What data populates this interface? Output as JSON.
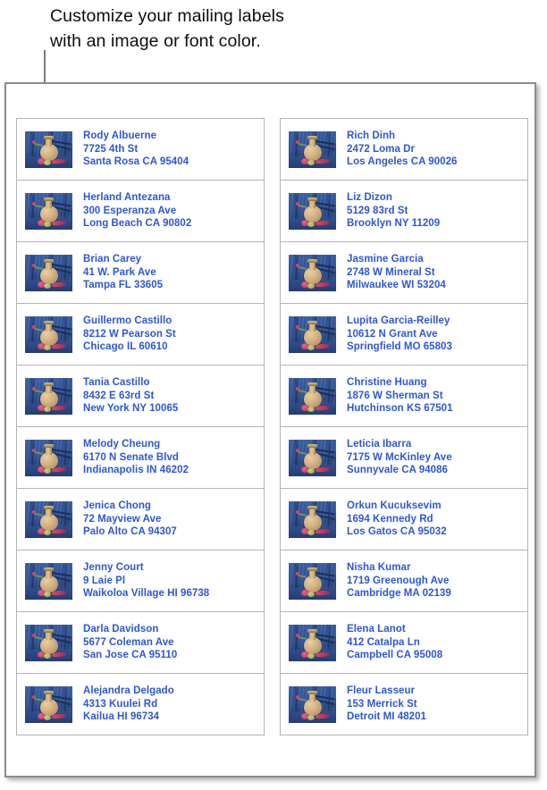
{
  "callout": {
    "text": "Customize your mailing labels\nwith an image or font color."
  },
  "page": {
    "image_name": "perfume-bottle-on-denim-photo",
    "text_color": "#2c57d8",
    "sheet_border_color": "#8c8c8c",
    "label_border_color": "#b4b4b4"
  },
  "labels": {
    "left": [
      {
        "name": "Rody Albuerne",
        "street": "7725 4th St",
        "city": "Santa Rosa CA 95404"
      },
      {
        "name": "Herland Antezana",
        "street": "300 Esperanza Ave",
        "city": "Long Beach CA 90802"
      },
      {
        "name": "Brian Carey",
        "street": "41 W. Park Ave",
        "city": "Tampa FL 33605"
      },
      {
        "name": "Guillermo Castillo",
        "street": "8212 W Pearson St",
        "city": "Chicago IL 60610"
      },
      {
        "name": "Tania Castillo",
        "street": "8432 E 63rd St",
        "city": "New York NY 10065"
      },
      {
        "name": "Melody Cheung",
        "street": "6170 N Senate Blvd",
        "city": "Indianapolis IN 46202"
      },
      {
        "name": "Jenica Chong",
        "street": "72 Mayview Ave",
        "city": "Palo Alto CA 94307"
      },
      {
        "name": "Jenny Court",
        "street": "9 Laie Pl",
        "city": "Waikoloa Village HI 96738"
      },
      {
        "name": "Darla Davidson",
        "street": "5677 Coleman Ave",
        "city": "San Jose CA 95110"
      },
      {
        "name": "Alejandra Delgado",
        "street": "4313 Kuulei Rd",
        "city": "Kailua HI 96734"
      }
    ],
    "right": [
      {
        "name": "Rich Dinh",
        "street": "2472 Loma Dr",
        "city": "Los Angeles CA 90026"
      },
      {
        "name": "Liz Dizon",
        "street": "5129 83rd St",
        "city": "Brooklyn NY 11209"
      },
      {
        "name": "Jasmine Garcia",
        "street": "2748 W Mineral St",
        "city": "Milwaukee WI 53204"
      },
      {
        "name": "Lupita Garcia-Reilley",
        "street": "10612 N Grant Ave",
        "city": "Springfield MO 65803"
      },
      {
        "name": "Christine Huang",
        "street": "1876 W Sherman St",
        "city": "Hutchinson KS 67501"
      },
      {
        "name": "Leticia Ibarra",
        "street": "7175 W McKinley Ave",
        "city": "Sunnyvale CA 94086"
      },
      {
        "name": "Orkun Kucuksevim",
        "street": "1694 Kennedy Rd",
        "city": "Los Gatos CA 95032"
      },
      {
        "name": "Nisha Kumar",
        "street": "1719 Greenough Ave",
        "city": "Cambridge MA 02139"
      },
      {
        "name": "Elena Lanot",
        "street": "412 Catalpa Ln",
        "city": "Campbell CA 95008"
      },
      {
        "name": "Fleur Lasseur",
        "street": "153 Merrick St",
        "city": "Detroit MI 48201"
      }
    ]
  }
}
